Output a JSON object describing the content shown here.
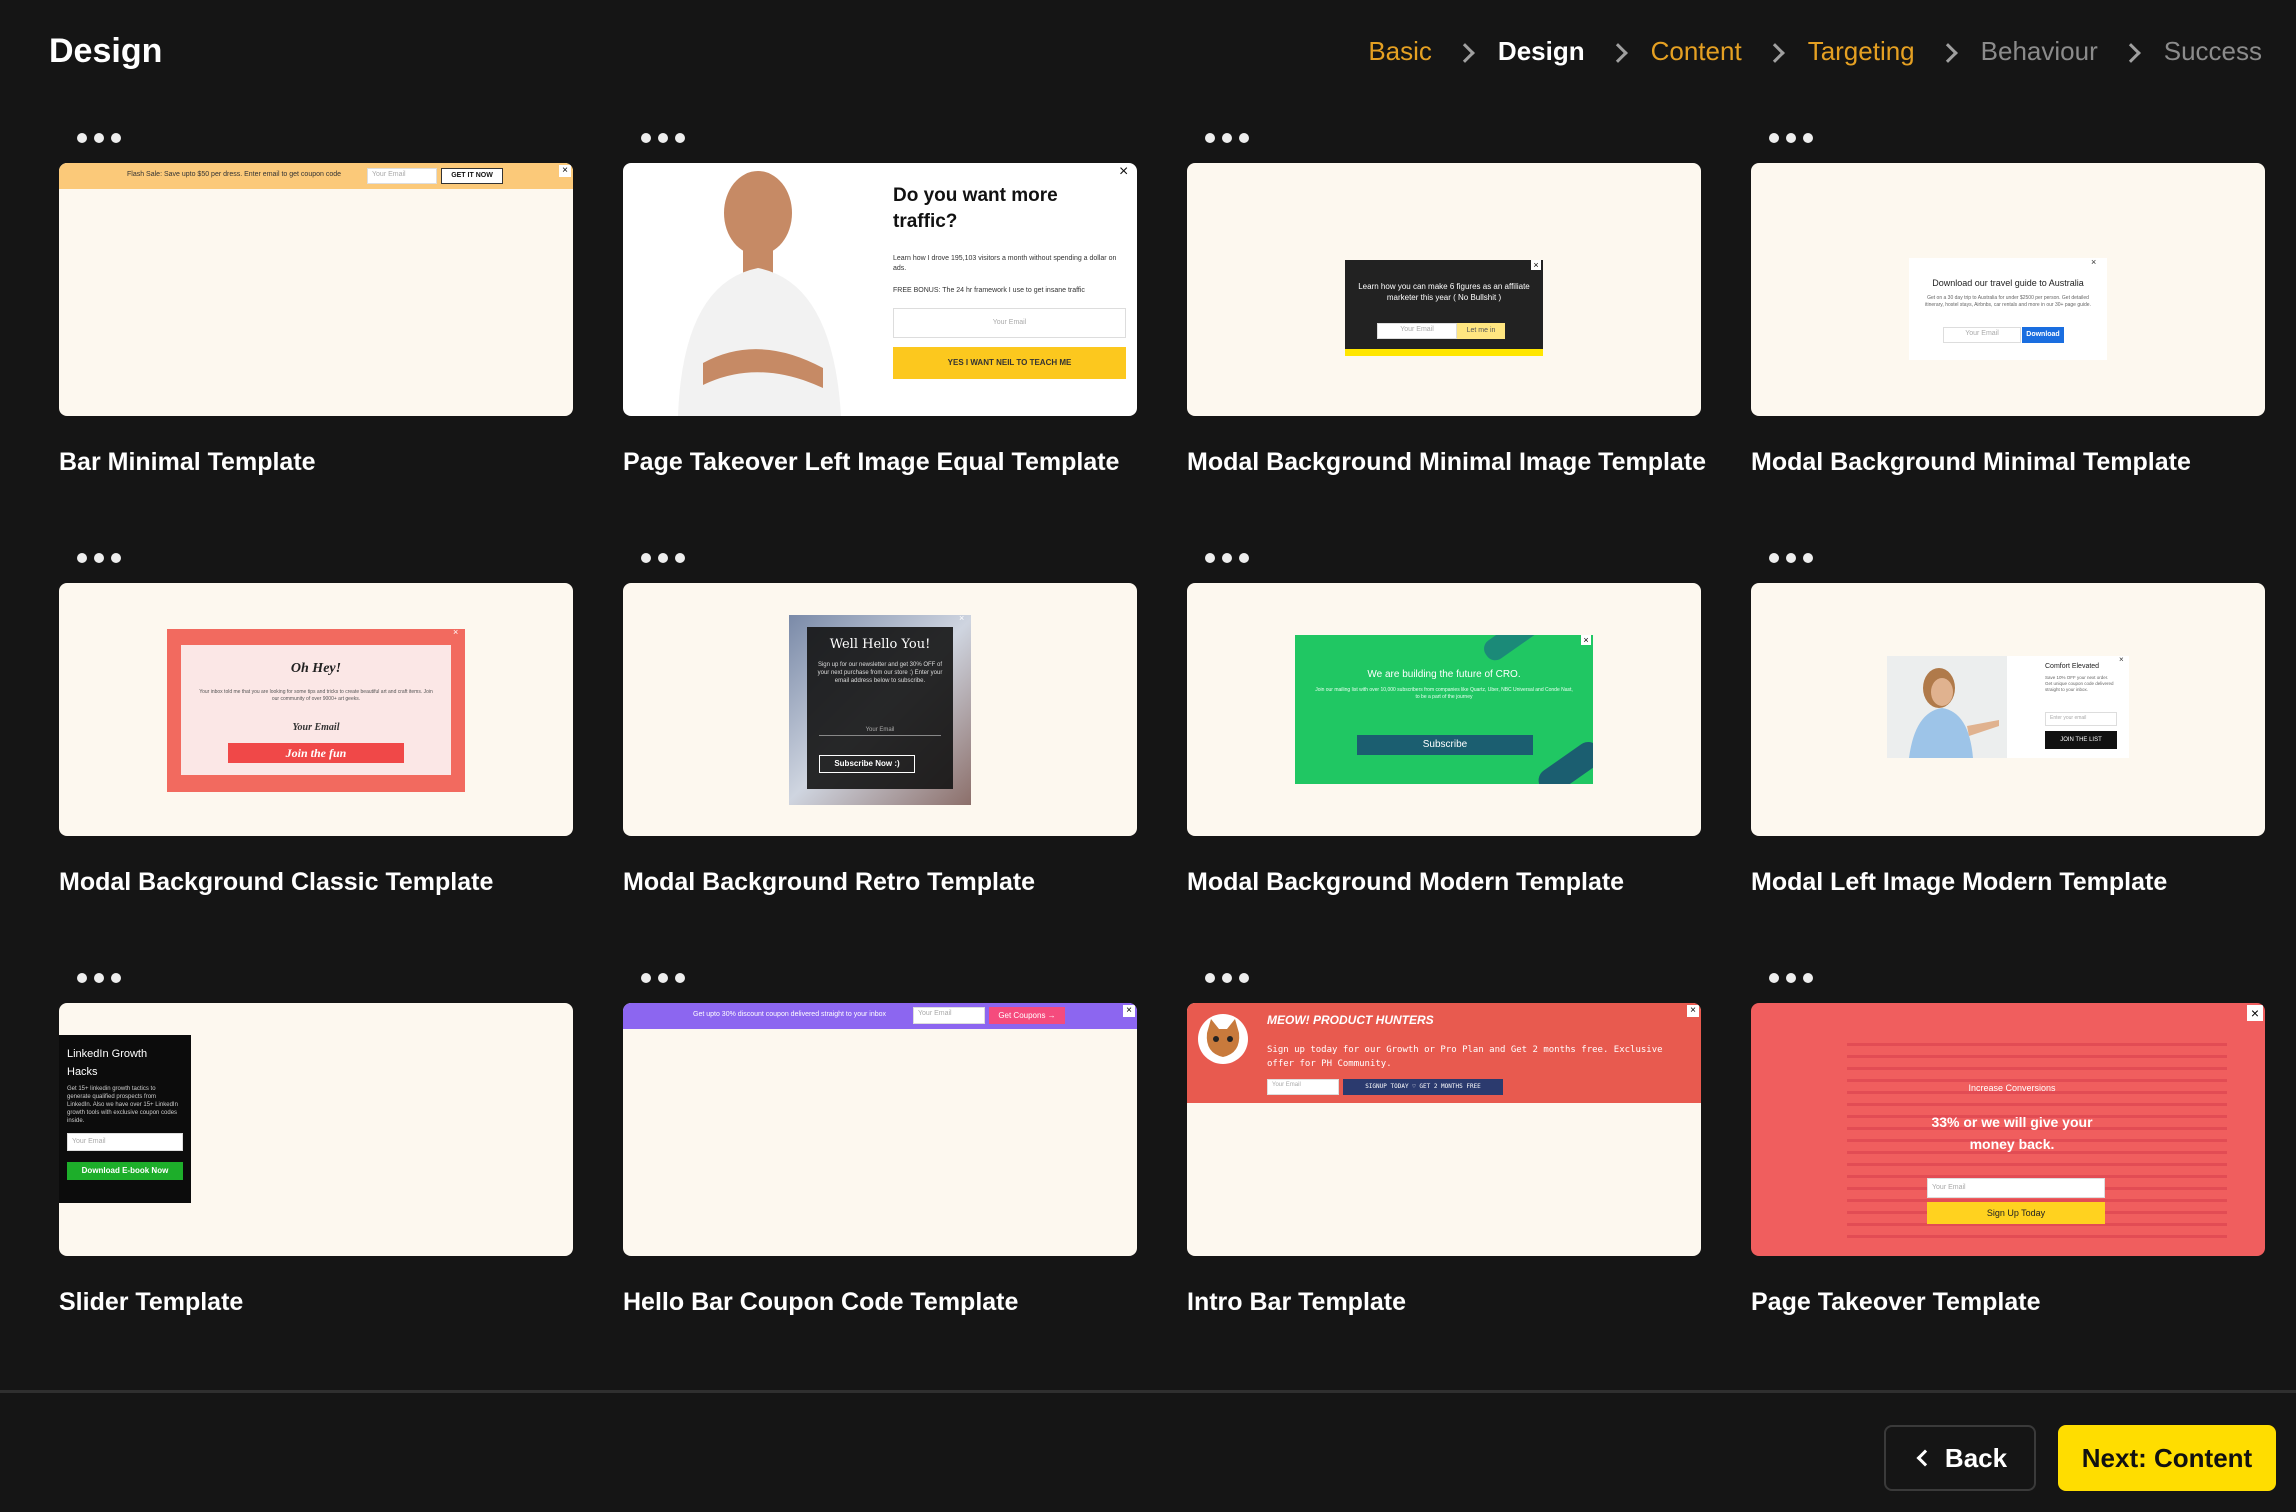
{
  "header": {
    "title": "Design",
    "steps": [
      {
        "label": "Basic",
        "state": "done"
      },
      {
        "label": "Design",
        "state": "active"
      },
      {
        "label": "Content",
        "state": "done"
      },
      {
        "label": "Targeting",
        "state": "done"
      },
      {
        "label": "Behaviour",
        "state": "future"
      },
      {
        "label": "Success",
        "state": "future"
      }
    ]
  },
  "templates": [
    {
      "name": "Bar Minimal Template",
      "preview": {
        "bar_text": "Flash Sale: Save upto $50 per dress. Enter email to get coupon code",
        "input": "Your Email",
        "button": "GET IT NOW"
      }
    },
    {
      "name": "Page Takeover Left Image Equal Template",
      "preview": {
        "heading": "Do you want more traffic?",
        "body": "Learn how I drove 195,103 visitors a month without spending a dollar on ads.",
        "bonus": "FREE BONUS: The 24 hr framework I use to get insane traffic",
        "input": "Your Email",
        "button": "YES I WANT NEIL TO TEACH ME"
      }
    },
    {
      "name": "Modal Background Minimal Image Template",
      "preview": {
        "text": "Learn how you can make 6 figures as an affiliate marketer this year ( No Bullshit )",
        "input": "Your Email",
        "button": "Let me in"
      }
    },
    {
      "name": "Modal Background Minimal Template",
      "preview": {
        "heading": "Download our travel guide to Australia",
        "body": "Get on a 30 day trip to Australia for under $2500 per person. Get detailed itinerary, hostel stays, Airbnbs, car rentals and more in our 30+ page guide.",
        "input": "Your Email",
        "button": "Download"
      }
    },
    {
      "name": "Modal Background Classic Template",
      "preview": {
        "heading": "Oh Hey!",
        "body": "Your inbox told me that you are looking for some tips and tricks to create beautiful art and craft items. Join our community of over 9000+ art geeks.",
        "input": "Your Email",
        "button": "Join the fun"
      }
    },
    {
      "name": "Modal Background Retro Template",
      "preview": {
        "heading": "Well Hello You!",
        "body": "Sign up for our newsletter and get 30% OFF of your next purchase from our store :) Enter your email address below to subscribe.",
        "input": "Your Email",
        "button": "Subscribe Now :)"
      }
    },
    {
      "name": "Modal Background Modern Template",
      "preview": {
        "heading": "We are building the future of CRO.",
        "body": "Join our mailing list with over 10,000 subscribers from companies like Quartz, Uber, NBC Universal and Conde Nast, to be a part of the journey",
        "button": "Subscribe"
      }
    },
    {
      "name": "Modal Left Image Modern Template",
      "preview": {
        "heading": "Comfort Elevated",
        "body": "Save 10% OFF your next order. Get unique coupon code delivered straight to your inbox.",
        "input": "Enter your email",
        "button": "JOIN THE LIST"
      }
    },
    {
      "name": "Slider Template",
      "preview": {
        "heading": "LinkedIn Growth Hacks",
        "body": "Get 15+ linkedin growth tactics to generate qualified prospects from LinkedIn. Also we have over 15+ LinkedIn growth tools with exclusive coupon codes inside.",
        "input": "Your Email",
        "button": "Download E-book Now"
      }
    },
    {
      "name": "Hello Bar Coupon Code Template",
      "preview": {
        "bar_text": "Get upto 30% discount coupon delivered straight to your inbox",
        "input": "Your Email",
        "button": "Get Coupons →"
      }
    },
    {
      "name": "Intro Bar Template",
      "preview": {
        "heading": "MEOW! PRODUCT HUNTERS",
        "body": "Sign up today for our Growth or Pro Plan and Get 2 months free. Exclusive offer for PH Community.",
        "input": "Your Email",
        "button": "SIGNUP TODAY ♡ GET 2 MONTHS FREE"
      }
    },
    {
      "name": "Page Takeover Template",
      "preview": {
        "tag": "Increase Conversions",
        "heading": "33% or we will give your money back.",
        "input": "Your Email",
        "button": "Sign Up Today"
      }
    }
  ],
  "footer": {
    "back_label": "Back",
    "next_label": "Next: Content"
  },
  "colors": {
    "background": "#151515",
    "accent": "#ffdd00",
    "step_done": "#e5a022",
    "step_future": "#8b8b8b",
    "thumb_bg": "#fdf8ef"
  }
}
